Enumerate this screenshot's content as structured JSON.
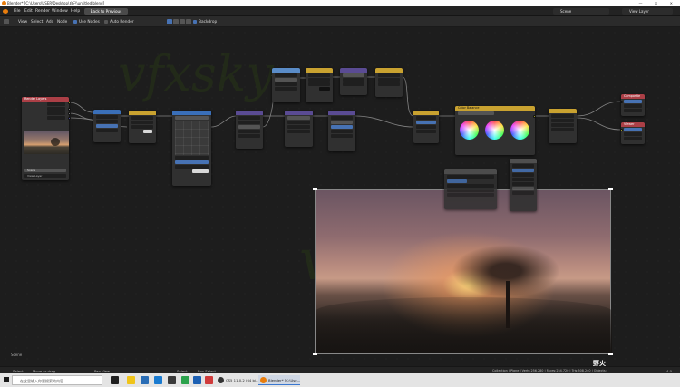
{
  "window": {
    "title": "Blender* [C:\\Users\\USER\\Desktop\\自己\\untitled.blend]",
    "controls": "— ☐ ✕"
  },
  "menu": {
    "items": [
      "File",
      "Edit",
      "Render",
      "Window",
      "Help"
    ],
    "back_button": "Back to Previous",
    "scene": "Scene",
    "view_layer": "View Layer"
  },
  "node_header": {
    "editor_type_icon": "node-editor-icon",
    "items": [
      "View",
      "Select",
      "Add",
      "Node"
    ],
    "use_nodes": "Use Nodes",
    "auto_render": "Auto Render",
    "backdrop": "Backdrop"
  },
  "nodes": {
    "render_layers": {
      "title": "Render Layers",
      "scene_label": "Scene",
      "layer_label": "View Layer"
    },
    "composite": "Composite",
    "viewer": "Viewer",
    "color_balance": "Color Balance"
  },
  "status_region": {
    "label": "Scene"
  },
  "statusbar": {
    "select": "Select",
    "box_select": "Move or drag",
    "pan_view": "Pan View",
    "select2": "Select",
    "box_select2": "Box Select",
    "stats": "Collection | Plane | Verts:256,280 | Faces:254,720 | Tris:508,240 | Objects:",
    "version": "4.0"
  },
  "taskbar": {
    "search_placeholder": "在这里输入你要搜索的内容",
    "apps": [
      "CS5 11.0.2 (64 bi...",
      "Blender* [C:\\Use..."
    ],
    "watermark_glyph": "野火",
    "tray_time": ""
  },
  "colors": {
    "accent": "#4772b3",
    "input_header": "#ab3f46",
    "color_header": "#c9a230",
    "filter_header": "#5a4b93",
    "converter_header": "#3a6fb8",
    "socket_color": "#c7c729",
    "socket_value": "#a1a1a1",
    "socket_vector": "#6363c7"
  },
  "watermark": {
    "text": "vfxsky"
  }
}
